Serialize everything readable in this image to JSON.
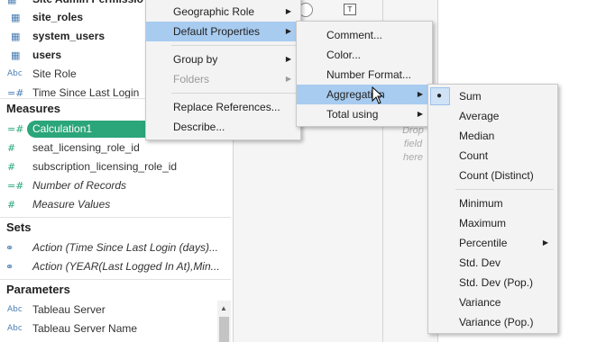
{
  "data_pane": {
    "top_partial_label": "Site Admin Permissio",
    "tables": [
      {
        "label": "site_roles"
      },
      {
        "label": "system_users"
      },
      {
        "label": "users"
      }
    ],
    "dimension_fields": [
      {
        "icon": "Abc",
        "label": "Site Role"
      },
      {
        "icon": "=#",
        "label": "Time Since Last Login"
      }
    ],
    "measures_header": "Measures",
    "measure_fields": [
      {
        "icon": "=#",
        "label": "Calculation1",
        "selected": true
      },
      {
        "icon": "#",
        "label": "seat_licensing_role_id"
      },
      {
        "icon": "#",
        "label": "subscription_licensing_role_id"
      },
      {
        "icon": "=#",
        "label": "Number of Records",
        "italic": true
      },
      {
        "icon": "#",
        "label": "Measure Values",
        "italic": true
      }
    ],
    "sets_header": "Sets",
    "set_fields": [
      {
        "label": "Action (Time Since Last Login (days)..."
      },
      {
        "label": "Action (YEAR(Last Logged In At),Min..."
      }
    ],
    "parameters_header": "Parameters",
    "parameter_fields": [
      {
        "icon": "Abc",
        "label": "Tableau Server"
      },
      {
        "icon": "Abc",
        "label": "Tableau Server Name"
      }
    ]
  },
  "drop_hint": [
    "Drop",
    "field",
    "here"
  ],
  "context_menu": {
    "items": [
      {
        "label": "Geographic Role",
        "submenu": true
      },
      {
        "label": "Default Properties",
        "submenu": true,
        "highlighted": true
      },
      {
        "label": "Group by",
        "submenu": true
      },
      {
        "label": "Folders",
        "submenu": true,
        "disabled": true
      },
      {
        "label": "Replace References..."
      },
      {
        "label": "Describe..."
      }
    ]
  },
  "default_properties_menu": {
    "items": [
      {
        "label": "Comment..."
      },
      {
        "label": "Color..."
      },
      {
        "label": "Number Format..."
      },
      {
        "label": "Aggregation",
        "submenu": true,
        "highlighted": true
      },
      {
        "label": "Total using",
        "submenu": true
      }
    ]
  },
  "aggregation_menu": {
    "selected": "Sum",
    "items": [
      {
        "label": "Sum"
      },
      {
        "label": "Average"
      },
      {
        "label": "Median"
      },
      {
        "label": "Count"
      },
      {
        "label": "Count (Distinct)"
      },
      {
        "label": "Minimum"
      },
      {
        "label": "Maximum"
      },
      {
        "label": "Percentile",
        "submenu": true
      },
      {
        "label": "Std. Dev"
      },
      {
        "label": "Std. Dev (Pop.)"
      },
      {
        "label": "Variance"
      },
      {
        "label": "Variance (Pop.)"
      }
    ]
  },
  "colors": {
    "calc_pill": "#2ba57a",
    "menu_highlight": "#a8ccf0",
    "menu_bg": "#f3f3f3"
  }
}
